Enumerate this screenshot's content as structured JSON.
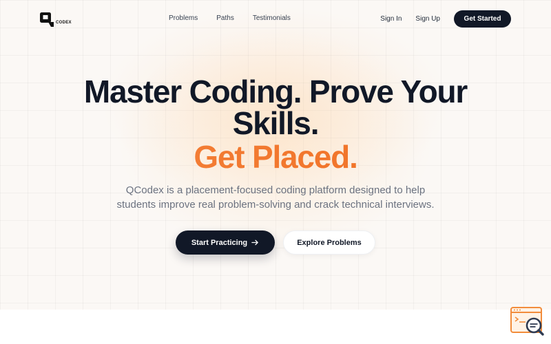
{
  "brand": {
    "logo_text": "CODEX"
  },
  "nav": {
    "links": [
      "Problems",
      "Paths",
      "Testimonials"
    ],
    "sign_in": "Sign In",
    "sign_up": "Sign Up",
    "get_started": "Get Started"
  },
  "hero": {
    "headline_line1": "Master Coding. Prove Your",
    "headline_line2": "Skills.",
    "headline_accent": "Get Placed.",
    "subtitle_line1": "QCodex is a placement-focused coding platform designed to help",
    "subtitle_line2": "students improve real problem-solving and crack technical interviews.",
    "primary_cta": "Start Practicing",
    "secondary_cta": "Explore Problems"
  },
  "icons": {
    "logo": "qcodex-logo-icon",
    "cta_arrow": "arrow-right-icon",
    "floating_widget": "code-search-icon"
  },
  "colors": {
    "dark": "#111827",
    "accent": "#f27a30",
    "background": "#fbf8f5"
  }
}
